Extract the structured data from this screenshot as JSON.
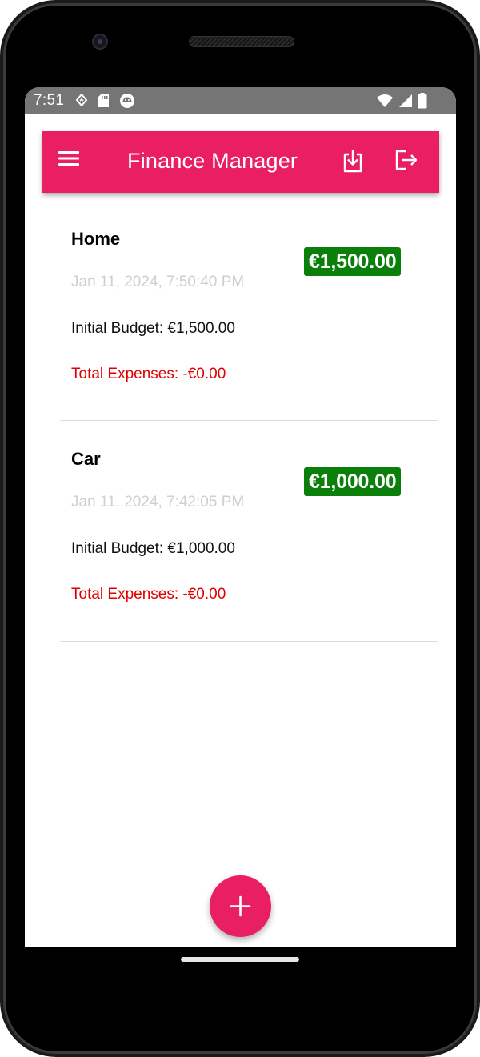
{
  "status_bar": {
    "time": "7:51",
    "left_icons": [
      "navigation-icon",
      "sd-card-icon",
      "android-icon"
    ],
    "right_icons": [
      "wifi-icon",
      "signal-icon",
      "battery-icon"
    ]
  },
  "app_bar": {
    "title": "Finance Manager",
    "menu_icon": "menu-icon",
    "download_icon": "download-icon",
    "logout_icon": "logout-icon",
    "background": "#e91e63"
  },
  "budgets": [
    {
      "name": "Home",
      "date": "Jan 11, 2024, 7:50:40 PM",
      "amount": "€1,500.00",
      "initial_budget": "Initial Budget: €1,500.00",
      "total_expenses": "Total Expenses: -€0.00"
    },
    {
      "name": "Car",
      "date": "Jan 11, 2024, 7:42:05 PM",
      "amount": "€1,000.00",
      "initial_budget": "Initial Budget: €1,000.00",
      "total_expenses": "Total Expenses: -€0.00"
    }
  ],
  "fab": {
    "icon": "plus-icon"
  },
  "colors": {
    "accent": "#e91e63",
    "amount_badge": "#0a7f0a",
    "expenses_text": "#e00000",
    "date_text": "#cfcfcf"
  }
}
